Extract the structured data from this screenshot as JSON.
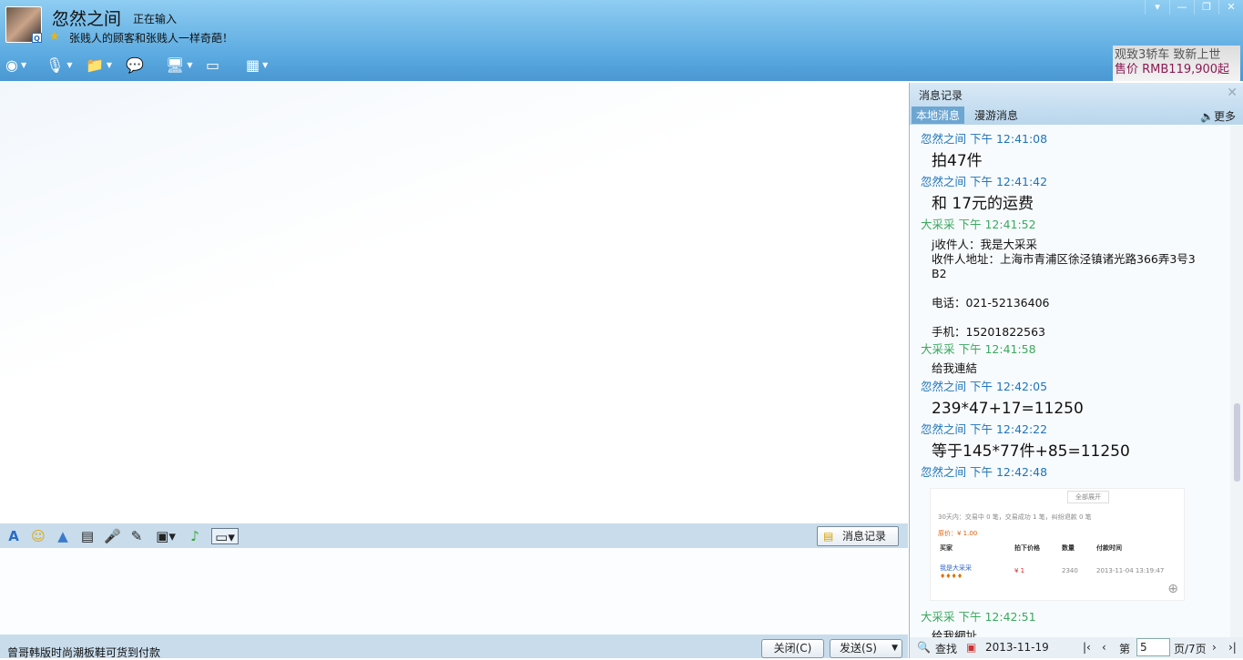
{
  "header": {
    "contact_name": "忽然之间",
    "status": "正在输入",
    "signature": "张贱人的顾客和张贱人一样奇葩！",
    "avatar_badge": "Q"
  },
  "toolbar": {
    "icons": [
      "video-call-icon",
      "voice-call-icon",
      "file-transfer-icon",
      "group-chat-icon",
      "remote-desktop-icon",
      "screen-share-icon",
      "apps-icon"
    ]
  },
  "ad": {
    "line1": "观致3轿车  致新上世",
    "line2": "售价 RMB119,900起"
  },
  "editor": {
    "history_button": "消息记录"
  },
  "footer": {
    "ticker": "曾哥韩版时尚潮板鞋可货到付款",
    "close": "关闭(C)",
    "send": "发送(S)"
  },
  "panel": {
    "title": "消息记录",
    "tabs": [
      "本地消息",
      "漫游消息"
    ],
    "more": "更多",
    "messages": [
      {
        "sender": "忽然之间 下午 12:41:08",
        "text": "拍47件"
      },
      {
        "sender": "忽然之间 下午 12:41:42",
        "text": "和  17元的运费"
      },
      {
        "sender": "大采采 下午 12:41:52",
        "lines": [
          "j收件人：我是大采采",
          "收件人地址：上海市青浦区徐泾镇诸光路366弄3号3",
          "B2",
          "",
          "电话：021-52136406",
          "",
          "手机：15201822563"
        ]
      },
      {
        "sender": "大采采 下午 12:41:58",
        "text": "给我連結"
      },
      {
        "sender": "忽然之间 下午 12:42:05",
        "text": "239*47+17=11250"
      },
      {
        "sender": "忽然之间 下午 12:42:22",
        "text": "等于145*77件+85=11250"
      },
      {
        "sender": "忽然之间 下午 12:42:48",
        "image": {
          "expand": "全部展开",
          "summary": "30天内：交易中 0 笔，交易成功 1 笔，纠纷退款 0 笔",
          "price": "原价：¥ 1.00",
          "headers": [
            "买家",
            "拍下价格",
            "数量",
            "付款时间"
          ],
          "row": [
            "我是大采采",
            "¥ 1",
            "2340",
            "2013-11-04 13:19:47"
          ]
        }
      },
      {
        "sender": "大采采 下午 12:42:51",
        "text": "给我網址"
      }
    ],
    "footer": {
      "search": "查找",
      "date": "2013-11-19",
      "page_prefix": "第",
      "page": "5",
      "page_suffix": "页/7页"
    }
  }
}
